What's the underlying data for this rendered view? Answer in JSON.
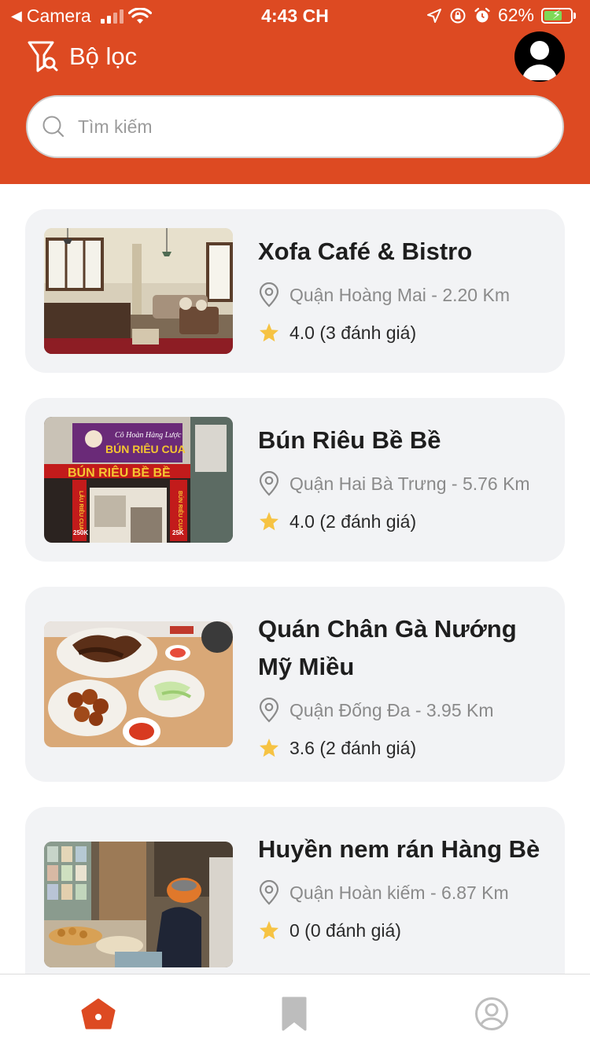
{
  "status_bar": {
    "back_app": "Camera",
    "time": "4:43 CH",
    "battery": "62%"
  },
  "header": {
    "filter_label": "Bộ lọc",
    "search_placeholder": "Tìm kiếm"
  },
  "colors": {
    "brand": "#dd4a22",
    "card_bg": "#f2f3f5",
    "star": "#f6c343",
    "tab_active": "#dd4a22",
    "tab_inactive": "#bdbdbd"
  },
  "restaurants": [
    {
      "name": "Xofa Café & Bistro",
      "location": "Quận Hoàng Mai - 2.20 Km",
      "rating": "4.0 (3 đánh giá)"
    },
    {
      "name": "Bún Riêu Bề Bề",
      "location": "Quận Hai Bà Trưng - 5.76 Km",
      "rating": "4.0 (2 đánh giá)"
    },
    {
      "name": "Quán Chân Gà Nướng Mỹ Miều",
      "location": "Quận Đống Đa - 3.95 Km",
      "rating": "3.6 (2 đánh giá)"
    },
    {
      "name": "Huyền nem rán Hàng Bè",
      "location": "Quận Hoàn kiếm - 6.87 Km",
      "rating": "0 (0 đánh giá)"
    }
  ],
  "signboard": {
    "line1": "Cô Hoàn Hàng Lược",
    "line2": "BÚN RIÊU CUA",
    "line3": "BÚN RIÊU BỀ BỀ",
    "side_left": "LẨU RIÊU CUA",
    "side_right": "BÚN RIÊU CUA",
    "price_left": "250K",
    "price_right": "25K"
  },
  "tabs": [
    {
      "name": "home",
      "icon": "home-icon",
      "active": true
    },
    {
      "name": "saved",
      "icon": "bookmark-icon",
      "active": false
    },
    {
      "name": "profile",
      "icon": "user-circle-icon",
      "active": false
    }
  ]
}
